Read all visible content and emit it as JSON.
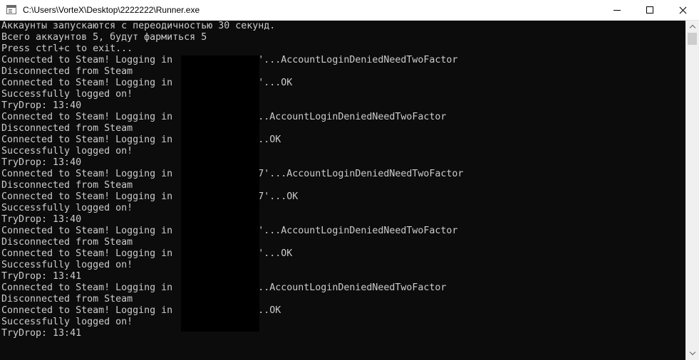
{
  "window": {
    "title": "C:\\Users\\VorteX\\Desktop\\2222222\\Runner.exe"
  },
  "console": {
    "lines": [
      "Аккаунты запускаются с переодичностью 30 секунд.",
      "Всего аккаунтов 5, будут фармиться 5",
      "Press ctrl+c to exit...",
      "Connected to Steam! Logging in               '...AccountLoginDeniedNeedTwoFactor",
      "Disconnected from Steam",
      "Connected to Steam! Logging in               '...OK",
      "Successfully logged on!",
      "TryDrop: 13:40",
      "Connected to Steam! Logging in              ...AccountLoginDeniedNeedTwoFactor",
      "Disconnected from Steam",
      "Connected to Steam! Logging in              ...OK",
      "Successfully logged on!",
      "TryDrop: 13:40",
      "Connected to Steam! Logging in              77'...AccountLoginDeniedNeedTwoFactor",
      "Disconnected from Steam",
      "Connected to Steam! Logging in              77'...OK",
      "Successfully logged on!",
      "TryDrop: 13:40",
      "Connected to Steam! Logging in              7'...AccountLoginDeniedNeedTwoFactor",
      "Disconnected from Steam",
      "Connected to Steam! Logging in              7'...OK",
      "Successfully logged on!",
      "TryDrop: 13:41",
      "Connected to Steam! Logging in              ...AccountLoginDeniedNeedTwoFactor",
      "Disconnected from Steam",
      "Connected to Steam! Logging in              ...OK",
      "Successfully logged on!",
      "TryDrop: 13:41"
    ]
  },
  "icons": {
    "app": "console-app-icon",
    "minimize": "minimize-icon",
    "maximize": "maximize-icon",
    "close": "close-icon",
    "scroll_up": "scroll-up-arrow-icon",
    "scroll_down": "scroll-down-arrow-icon"
  },
  "colors": {
    "console_background": "#0c0c0c",
    "console_text": "#cccccc",
    "titlebar_background": "#ffffff"
  }
}
